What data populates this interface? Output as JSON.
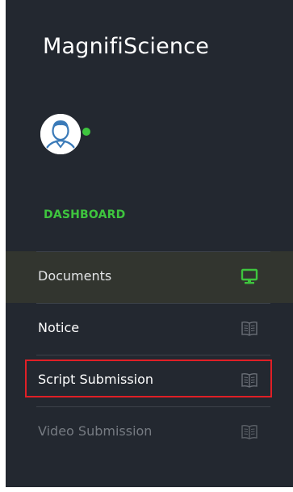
{
  "app": {
    "brand": "MagnifiScience"
  },
  "user": {
    "avatar_icon": "user-avatar-icon",
    "status": "online",
    "status_color": "#3ec53e"
  },
  "sidebar": {
    "section_label": "DASHBOARD",
    "items": [
      {
        "label": "Documents",
        "icon": "monitor-icon",
        "active": true,
        "icon_color": "#3ec53e"
      },
      {
        "label": "Notice",
        "icon": "book-icon",
        "active": false
      },
      {
        "label": "Script Submission",
        "icon": "book-icon",
        "active": false,
        "highlighted": true
      },
      {
        "label": "Video Submission",
        "icon": "book-icon",
        "active": false,
        "dimmed": true
      }
    ]
  },
  "colors": {
    "sidebar_bg": "#232830",
    "active_item_bg": "#32352f",
    "accent": "#3ec53e",
    "highlight_border": "#e01f26"
  }
}
